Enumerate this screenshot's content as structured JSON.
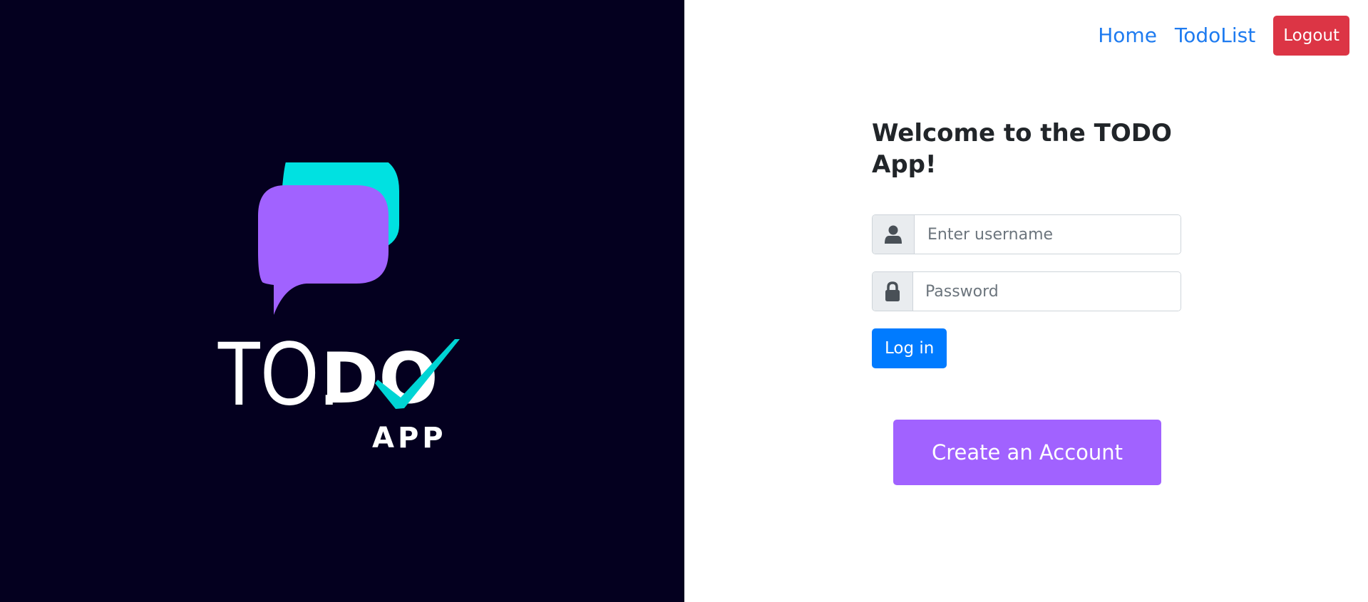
{
  "branding": {
    "logo_text": "TO.DO",
    "logo_subtext": "APP",
    "colors": {
      "background": "#04001f",
      "bubble_back": "#00e1e1",
      "bubble_front": "#a162ff",
      "text": "#ffffff",
      "checkmark": "#00d4d4"
    }
  },
  "nav": {
    "links": [
      {
        "label": "Home"
      },
      {
        "label": "TodoList"
      }
    ],
    "logout_label": "Logout"
  },
  "login": {
    "title": "Welcome to the TODO App!",
    "username": {
      "value": "",
      "placeholder": "Enter username",
      "icon": "user-icon"
    },
    "password": {
      "value": "",
      "placeholder": "Password",
      "icon": "lock-icon"
    },
    "submit_label": "Log in"
  },
  "signup": {
    "label": "Create an Account"
  },
  "colors": {
    "link": "#1e7bf0",
    "danger": "#dc3545",
    "primary": "#007bff",
    "accent": "#a162ff"
  }
}
